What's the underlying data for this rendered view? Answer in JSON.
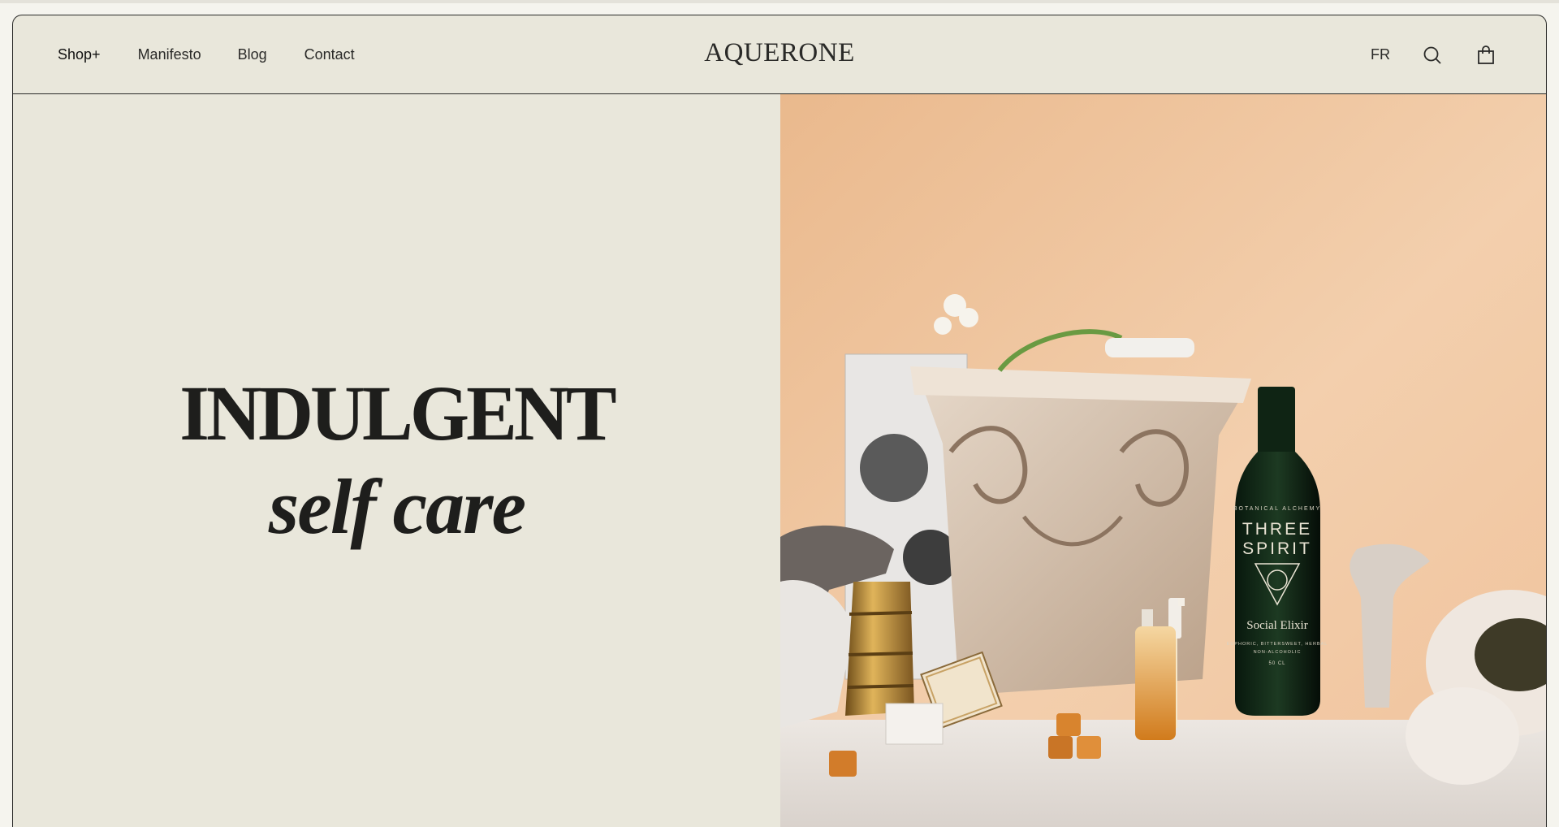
{
  "nav": {
    "left_links": [
      "Shop+",
      "Manifesto",
      "Blog",
      "Contact"
    ],
    "logo": "AQUERONE",
    "language": "FR",
    "icons": [
      "search-icon",
      "cart-icon"
    ]
  },
  "hero": {
    "headline_line1": "INDULGENT",
    "headline_line2": "self care"
  },
  "product_label": {
    "top": "BOTANICAL ALCHEMY",
    "brand_line1": "THREE",
    "brand_line2": "SPIRIT",
    "name": "Social Elixir",
    "descriptor": "EUPHORIC, BITTERSWEET, HERBAL",
    "non_alcoholic": "NON-ALCOHOLIC",
    "volume": "50 CL"
  },
  "colors": {
    "background": "#e9e7db",
    "accent_peach": "#f0c29b",
    "ink": "#1e1e1c"
  }
}
